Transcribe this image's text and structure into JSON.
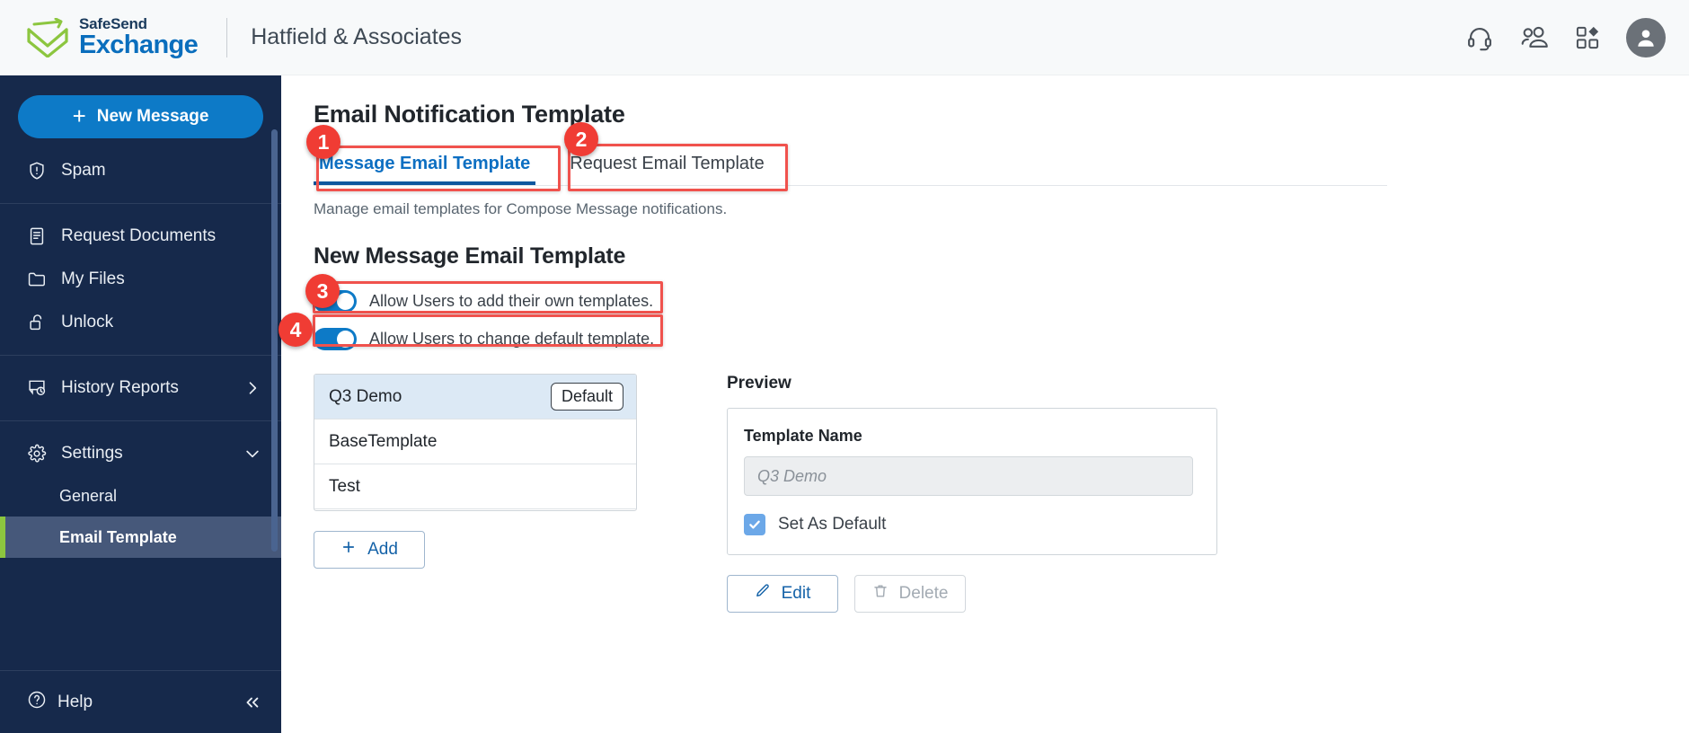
{
  "header": {
    "logo_top": "SafeSend",
    "logo_bottom": "Exchange",
    "org_name": "Hatfield & Associates",
    "icons": [
      "headset-icon",
      "contacts-icon",
      "apps-grid-icon",
      "user-avatar-icon"
    ]
  },
  "sidebar": {
    "new_message": "New Message",
    "new_message_plus": "+",
    "items": [
      {
        "label": "Spam",
        "icon": "shield-alert-icon"
      },
      {
        "label": "Request Documents",
        "icon": "document-icon"
      },
      {
        "label": "My Files",
        "icon": "folder-icon"
      },
      {
        "label": "Unlock",
        "icon": "unlock-icon"
      },
      {
        "label": "History Reports",
        "icon": "history-report-icon",
        "chevron": "chevron-right-icon"
      },
      {
        "label": "Settings",
        "icon": "gear-icon",
        "chevron": "chevron-down-icon"
      }
    ],
    "sub_items": [
      {
        "label": "General",
        "active": false
      },
      {
        "label": "Email Template",
        "active": true
      }
    ],
    "help": "Help",
    "collapse_icon": "chevrons-left-icon"
  },
  "main": {
    "page_title": "Email Notification Template",
    "tabs": [
      {
        "label": "Message Email Template",
        "active": true
      },
      {
        "label": "Request Email Template",
        "active": false
      }
    ],
    "subtitle": "Manage email templates for Compose Message notifications.",
    "section_title": "New Message Email Template",
    "toggles": [
      {
        "label": "Allow Users to add their own templates.",
        "on": true
      },
      {
        "label": "Allow Users to change default template.",
        "on": true
      }
    ],
    "template_list": [
      {
        "name": "Q3 Demo",
        "selected": true,
        "badge": "Default"
      },
      {
        "name": "BaseTemplate",
        "selected": false,
        "badge": ""
      },
      {
        "name": "Test",
        "selected": false,
        "badge": ""
      }
    ],
    "add_button": "Add",
    "add_button_icon": "plus-icon",
    "preview": {
      "label": "Preview",
      "field_label": "Template Name",
      "field_placeholder": "Q3 Demo",
      "checkbox_label": "Set As Default",
      "checkbox_checked": true,
      "edit_button": "Edit",
      "edit_button_icon": "pencil-icon",
      "delete_button": "Delete",
      "delete_button_icon": "trash-icon"
    }
  },
  "annotations": [
    {
      "number": "1"
    },
    {
      "number": "2"
    },
    {
      "number": "3"
    },
    {
      "number": "4"
    }
  ],
  "colors": {
    "accent_blue": "#0d7ac7",
    "sidebar_bg": "#16294b",
    "annotation_red": "#f03c34",
    "active_green": "#8cc63f"
  }
}
